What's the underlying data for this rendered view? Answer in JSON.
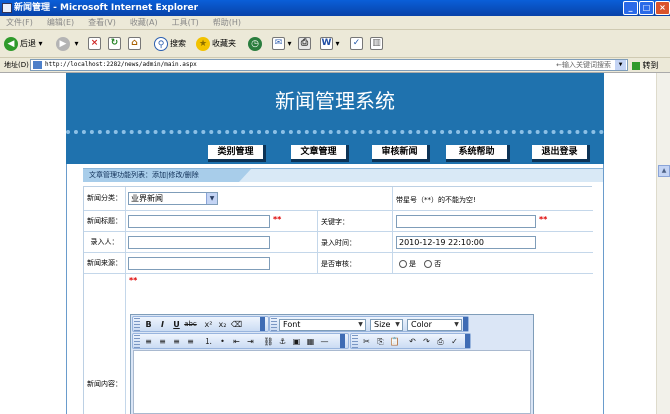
{
  "window": {
    "title": "新闻管理 - Microsoft Internet Explorer",
    "min": "_",
    "max": "□",
    "close": "×"
  },
  "menu": [
    "文件(F)",
    "编辑(E)",
    "查看(V)",
    "收藏(A)",
    "工具(T)",
    "帮助(H)"
  ],
  "toolbar": {
    "back": "后退",
    "search": "搜索",
    "favorites": "收藏夹"
  },
  "address": {
    "label": "地址(D)",
    "url": "http://localhost:2282/news/admin/main.aspx",
    "search_placeholder": "←输入关键词搜索",
    "go": "转到"
  },
  "site": {
    "title": "新闻管理系统",
    "nav": [
      "类别管理",
      "文章管理",
      "审核新闻",
      "系统帮助",
      "退出登录"
    ]
  },
  "breadcrumb": "文章管理功能列表：添加|修改/删除",
  "form": {
    "category_label": "新闻分类：",
    "category_value": "业界新闻",
    "required_note": "带星号（**）的不能为空!",
    "title_label": "新闻标题：",
    "title_value": "",
    "keyword_label": "关键字：",
    "keyword_value": "",
    "recorder_label": "录入人：",
    "recorder_value": "",
    "time_label": "录入时间：",
    "time_value": "2010-12-19 22:10:00",
    "source_label": "新闻来源：",
    "source_value": "",
    "audit_label": "是否审核：",
    "audit_yes": "是",
    "audit_no": "否",
    "content_label": "新闻内容：",
    "star": "**"
  },
  "editor": {
    "font": "Font",
    "size": "Size",
    "color": "Color"
  }
}
